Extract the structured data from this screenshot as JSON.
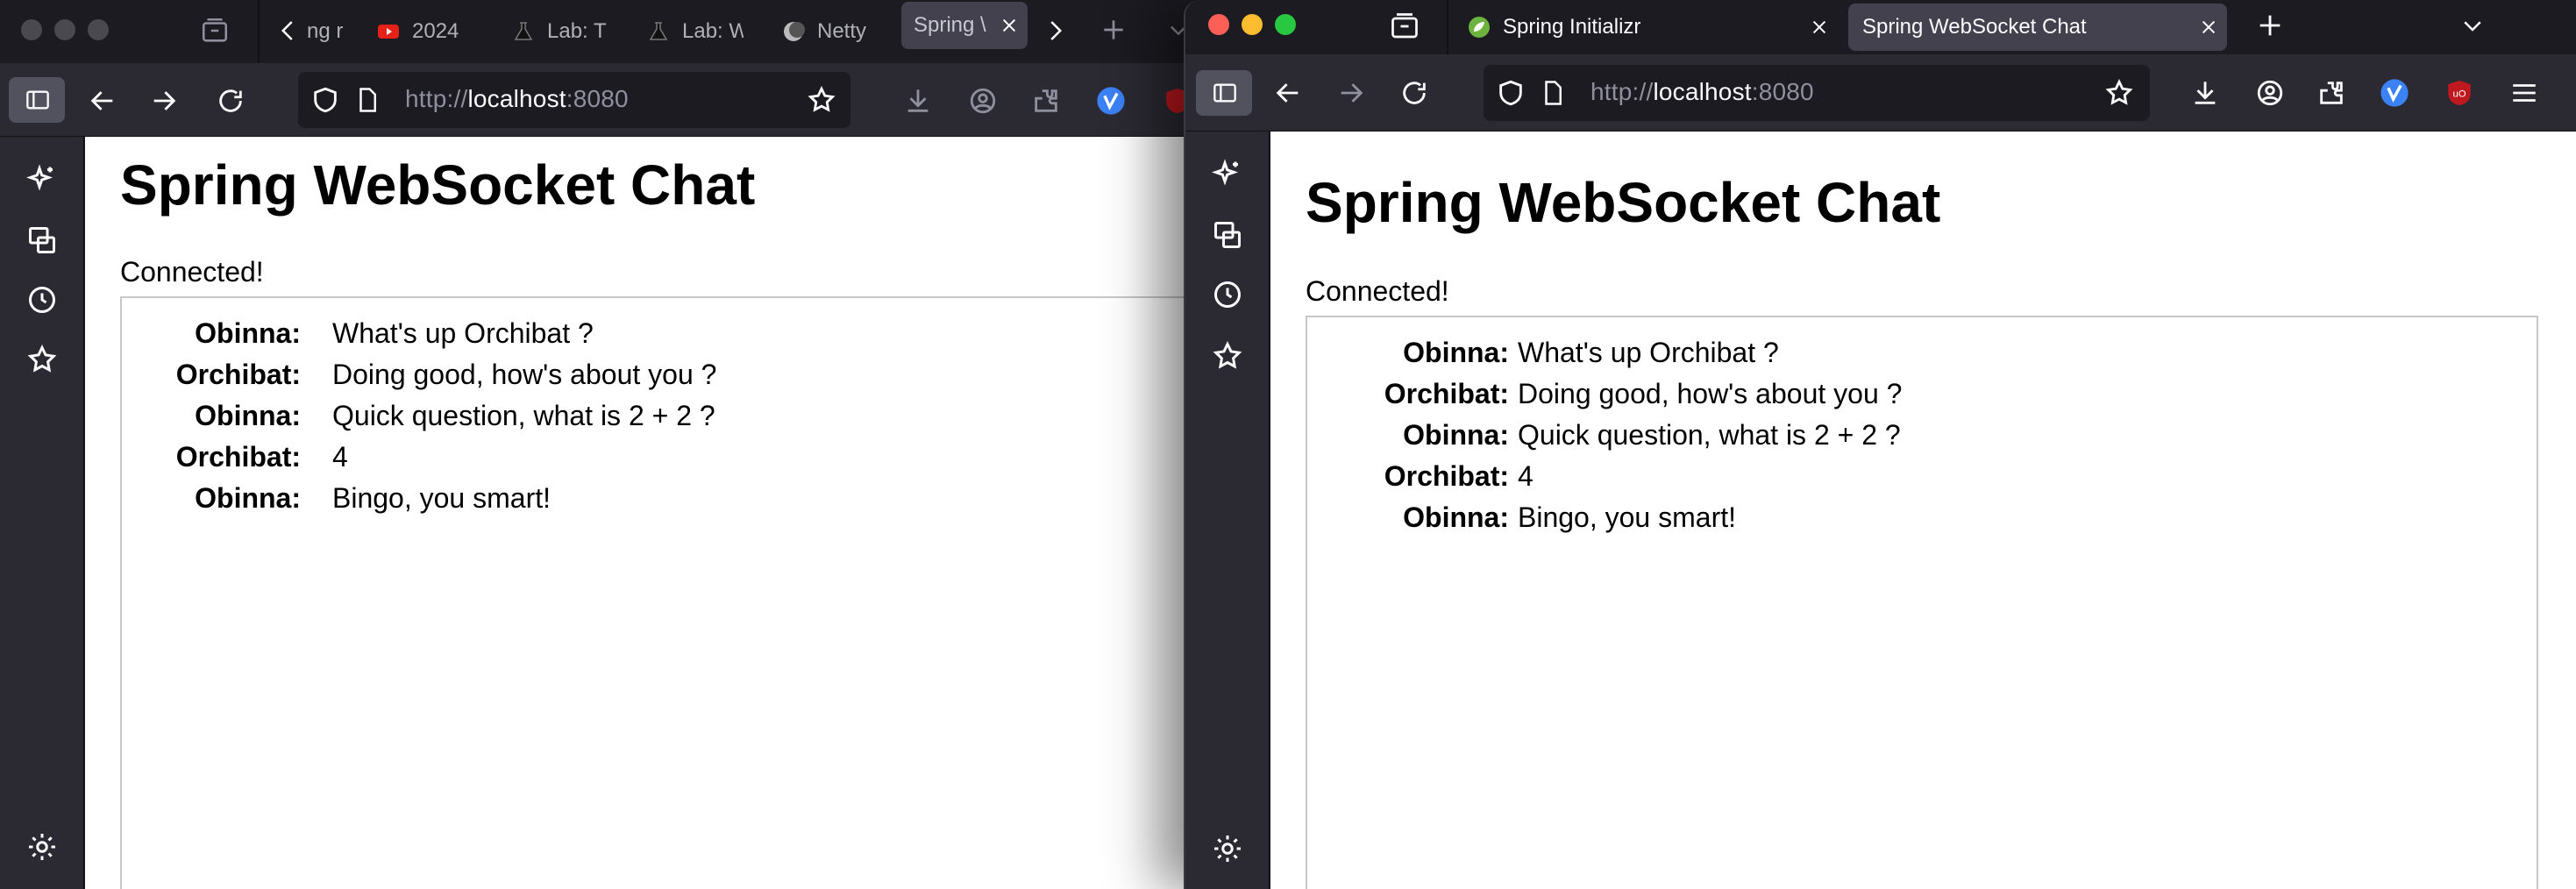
{
  "left_window": {
    "tabs": [
      {
        "label": "ng r",
        "favicon": "generic"
      },
      {
        "label": "2024",
        "favicon": "youtube-icon"
      },
      {
        "label": "Lab: T",
        "favicon": "flask-icon"
      },
      {
        "label": "Lab: W",
        "favicon": "flask-icon"
      },
      {
        "label": "Netty",
        "favicon": "moon-icon"
      },
      {
        "label": "Spring \\",
        "favicon": "none",
        "active": true
      }
    ],
    "url": {
      "scheme": "http://",
      "host": "localhost",
      "port": ":8080"
    }
  },
  "right_window": {
    "tabs": [
      {
        "label": "Spring Initializr",
        "favicon": "spring-leaf-icon"
      },
      {
        "label": "Spring WebSocket Chat",
        "favicon": "none",
        "active": true
      }
    ],
    "url": {
      "scheme": "http://",
      "host": "localhost",
      "port": ":8080"
    }
  },
  "page": {
    "title": "Spring WebSocket Chat",
    "status": "Connected!",
    "messages": [
      {
        "sender": "Obinna:",
        "text": "What's up Orchibat ?"
      },
      {
        "sender": "Orchibat:",
        "text": "Doing good, how's about you ?"
      },
      {
        "sender": "Obinna:",
        "text": "Quick question, what is 2 + 2 ?"
      },
      {
        "sender": "Orchibat:",
        "text": "4"
      },
      {
        "sender": "Obinna:",
        "text": "Bingo, you smart!"
      }
    ]
  },
  "colors": {
    "chrome_dark": "#1c1b22",
    "toolbar": "#2b2a33",
    "active_tab": "#42414d",
    "accent_blue": "#3b82f6",
    "ublock_red": "#c0181f"
  }
}
